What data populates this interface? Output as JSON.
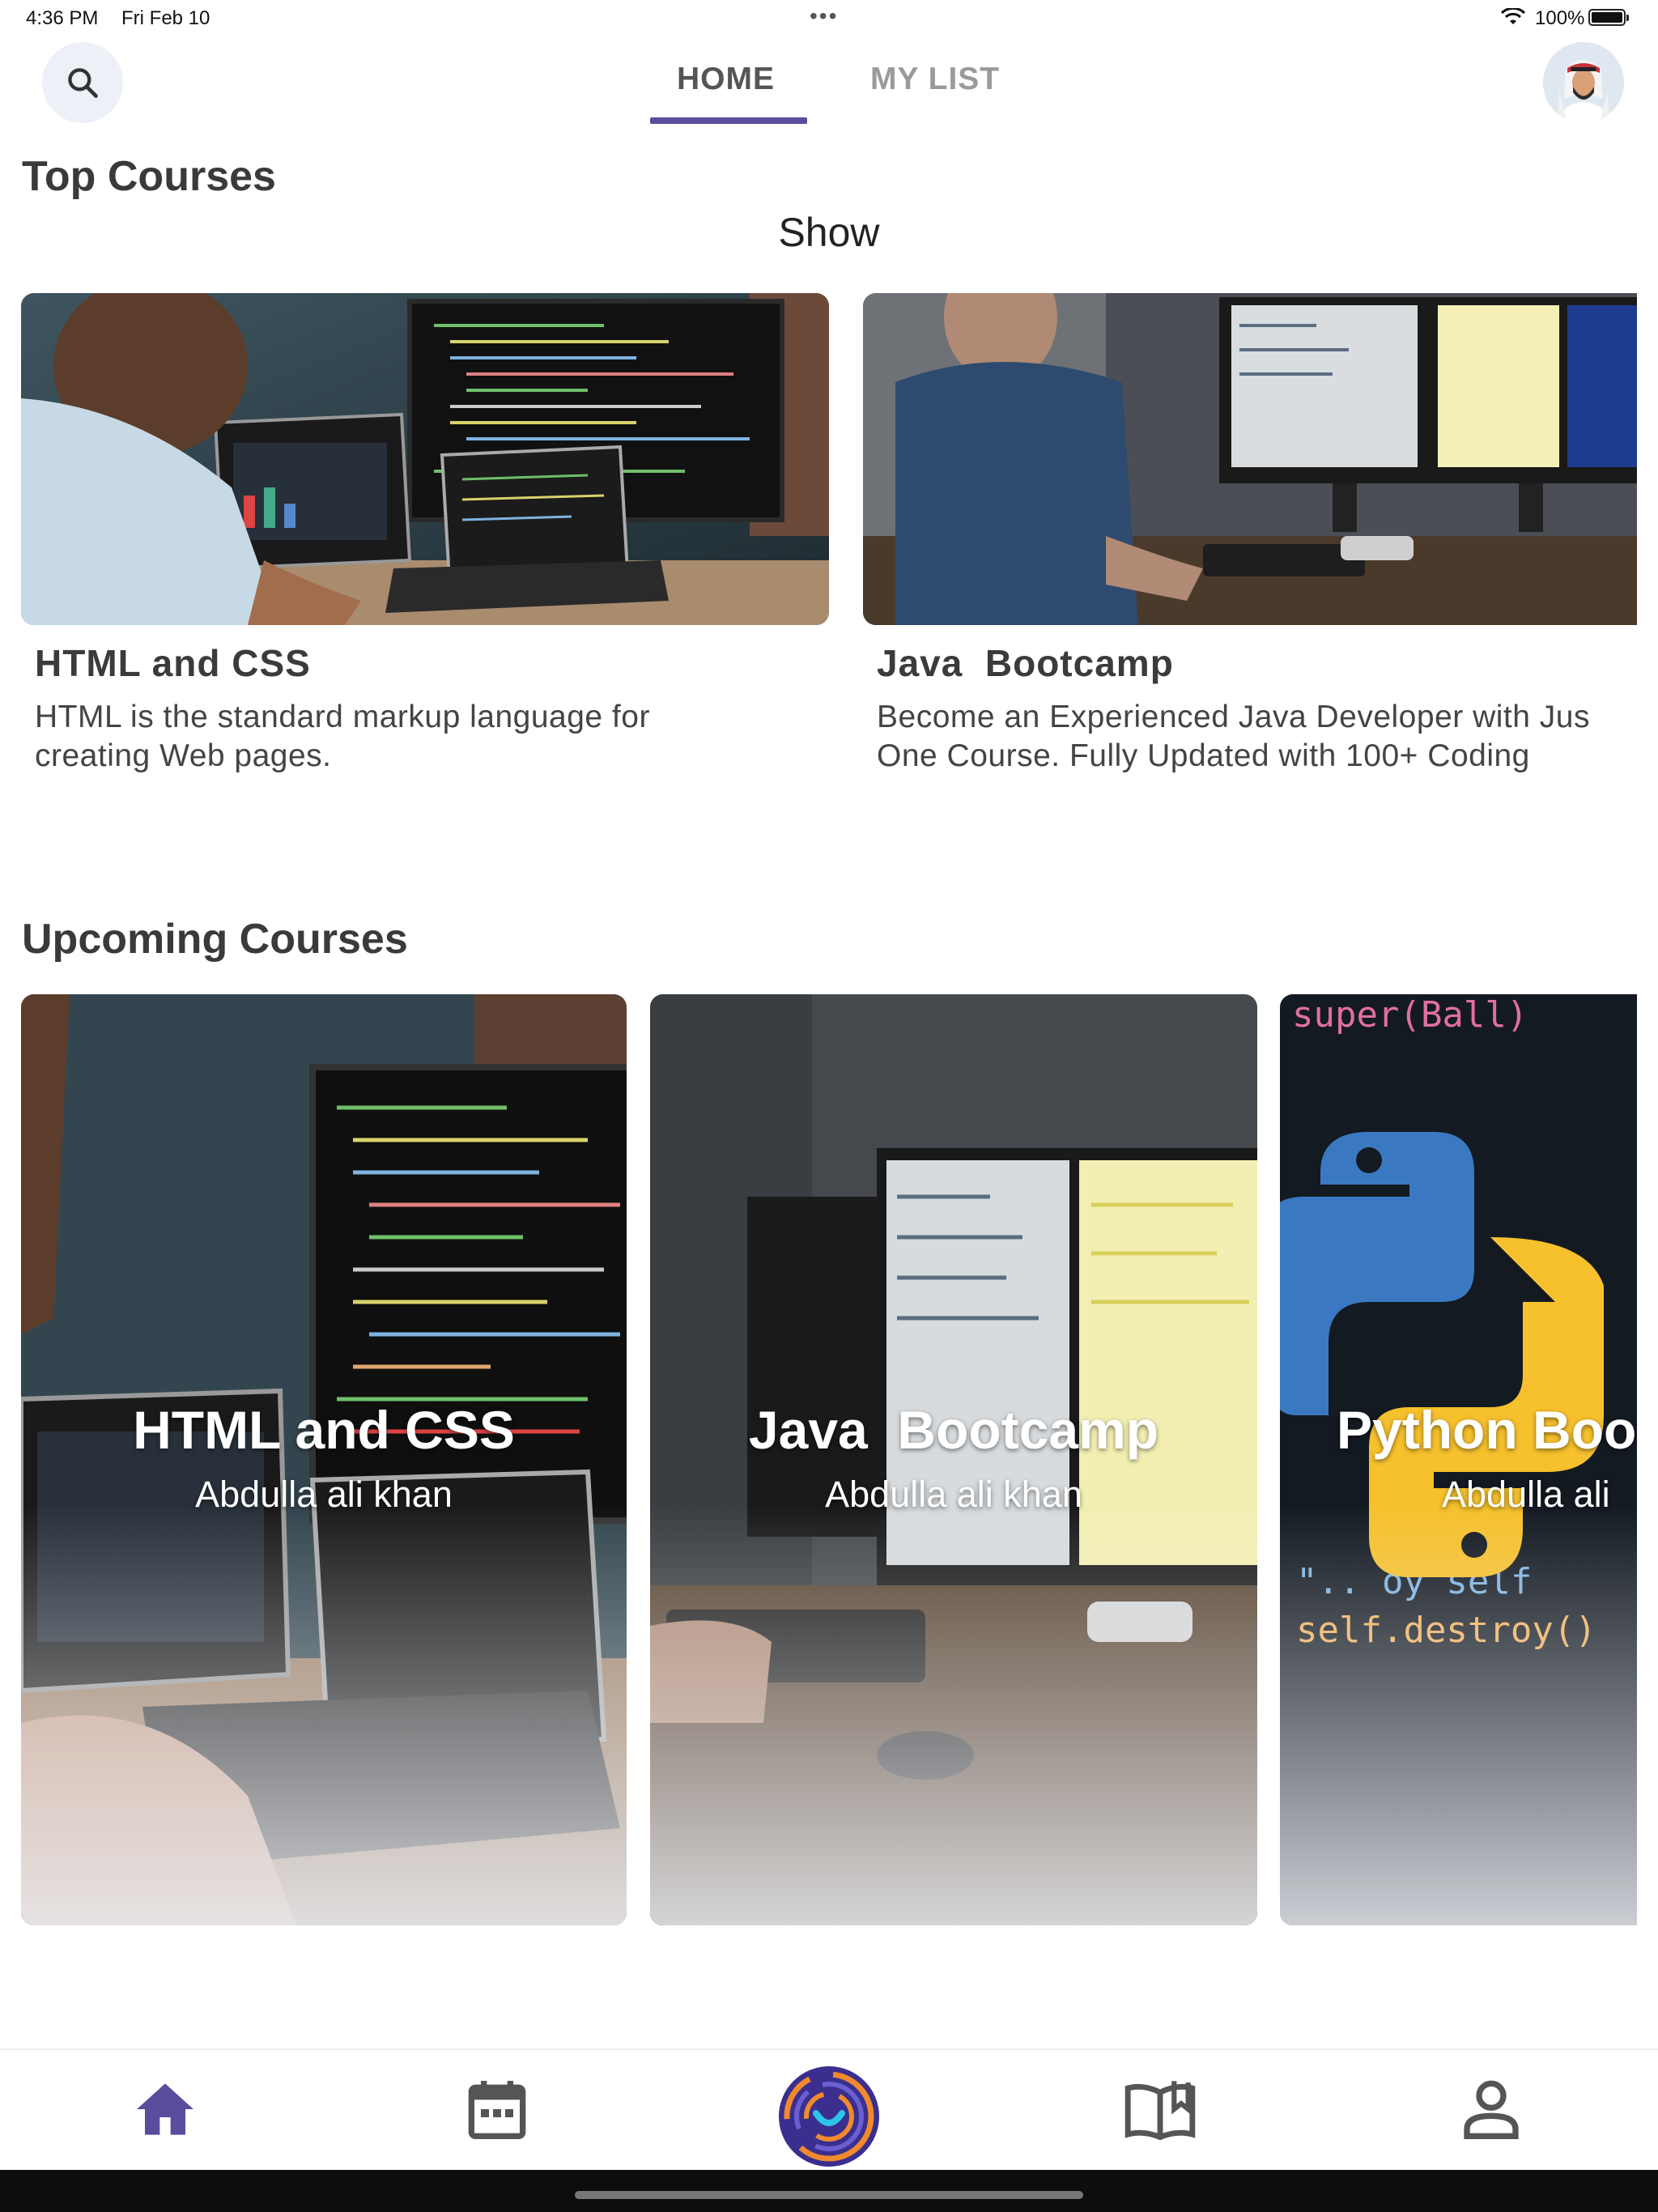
{
  "status_bar": {
    "time": "4:36 PM",
    "date": "Fri Feb 10",
    "dots": "•••",
    "battery": "100%"
  },
  "header": {
    "tabs": [
      {
        "label": "HOME",
        "active": true
      },
      {
        "label": "MY LIST",
        "active": false
      }
    ]
  },
  "top_courses": {
    "title": "Top Courses",
    "show_label": "Show",
    "items": [
      {
        "title": "HTML and CSS",
        "description": "HTML is the standard markup language for creating Web pages."
      },
      {
        "title": "Java  Bootcamp",
        "description": "Become an Experienced Java Developer with Jus One Course. Fully Updated with 100+ Coding"
      }
    ]
  },
  "upcoming_courses": {
    "title": "Upcoming Courses",
    "items": [
      {
        "title": "HTML and CSS",
        "author": "Abdulla ali khan"
      },
      {
        "title": "Java  Bootcamp",
        "author": "Abdulla ali khan"
      },
      {
        "title": "Python Boo",
        "author": "Abdulla ali"
      }
    ]
  },
  "bottom_nav": {
    "items": [
      "home-icon",
      "calendar-icon",
      "app-logo-icon",
      "book-icon",
      "profile-icon"
    ]
  },
  "colors": {
    "accent": "#5b4c9e",
    "logo_orange": "#f08a2c",
    "logo_cyan": "#2ec4e8"
  }
}
